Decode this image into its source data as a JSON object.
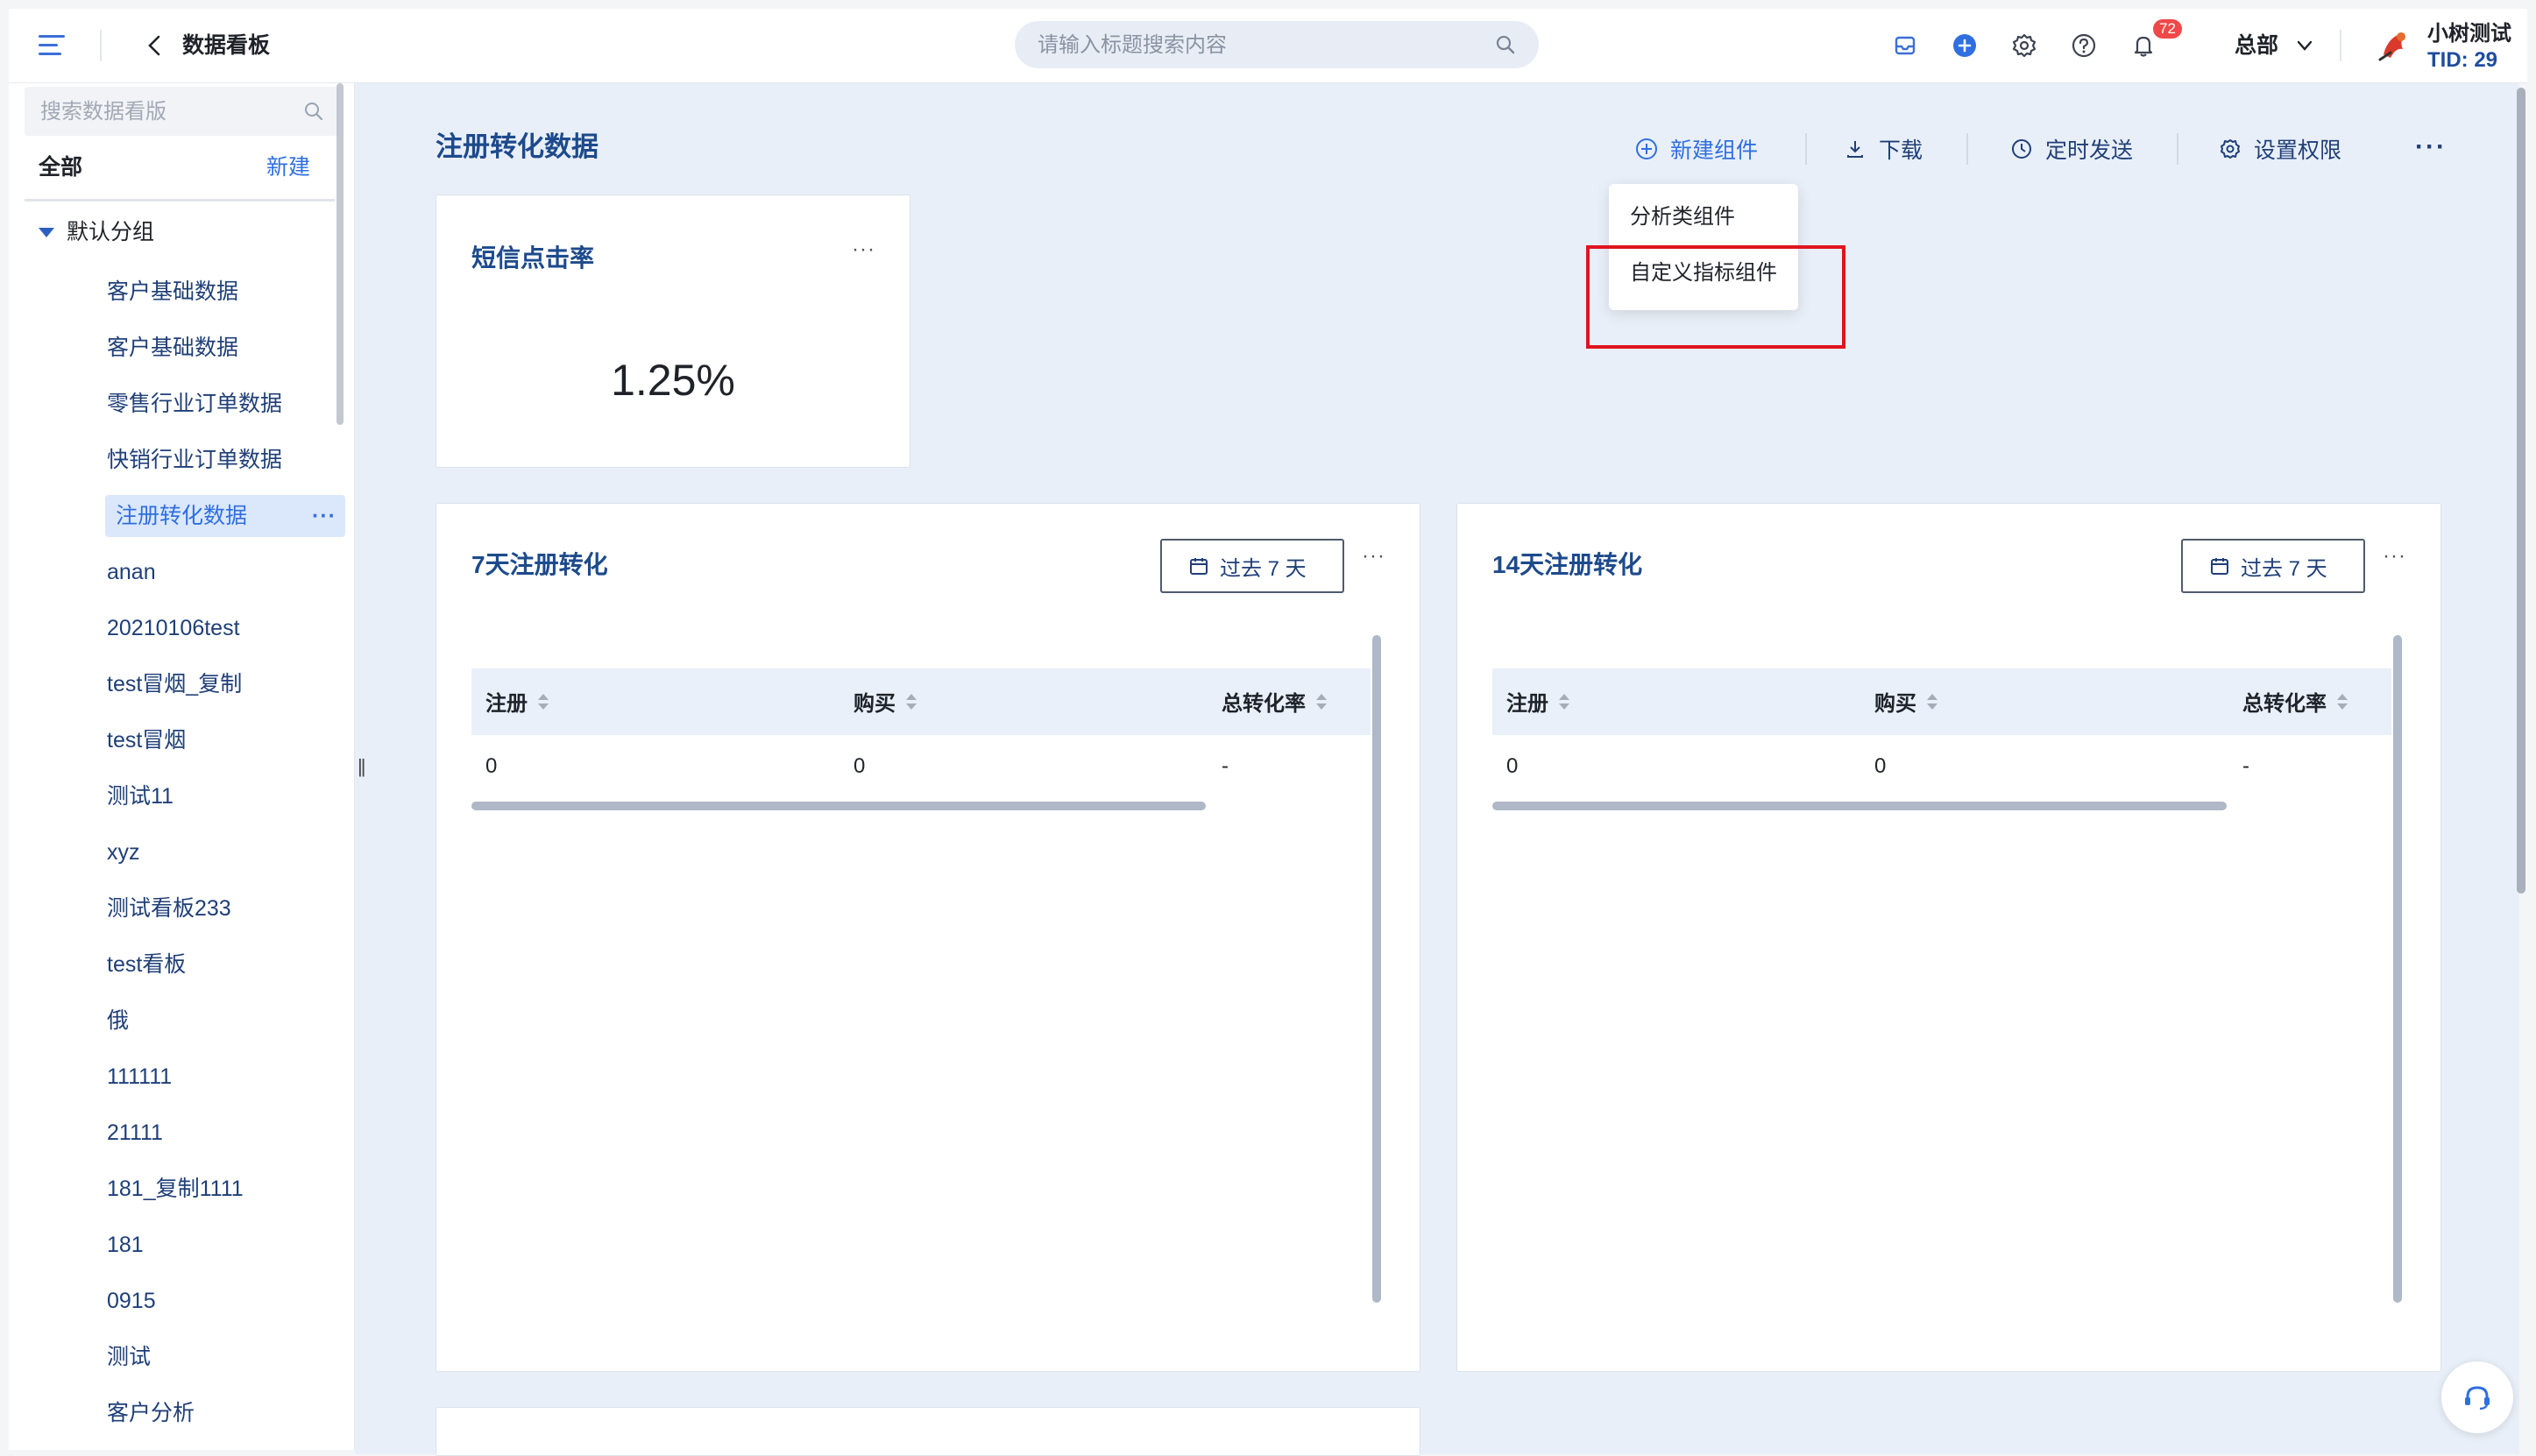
{
  "header": {
    "page_name": "数据看板",
    "search_placeholder": "请输入标题搜索内容",
    "notification_count": "72",
    "org_name": "总部",
    "user_name": "小树测试",
    "user_tid": "TID: 29"
  },
  "sidebar": {
    "search_placeholder": "搜索数据看版",
    "all_label": "全部",
    "new_label": "新建",
    "group_label": "默认分组",
    "items": [
      {
        "label": "客户基础数据"
      },
      {
        "label": "客户基础数据"
      },
      {
        "label": "零售行业订单数据"
      },
      {
        "label": "快销行业订单数据"
      },
      {
        "label": "注册转化数据",
        "active": true
      },
      {
        "label": "anan"
      },
      {
        "label": "20210106test"
      },
      {
        "label": "test冒烟_复制"
      },
      {
        "label": "test冒烟"
      },
      {
        "label": "测试11"
      },
      {
        "label": "xyz"
      },
      {
        "label": "测试看板233"
      },
      {
        "label": "test看板"
      },
      {
        "label": "俄"
      },
      {
        "label": "111111"
      },
      {
        "label": "21111"
      },
      {
        "label": "181_复制1111"
      },
      {
        "label": "181"
      },
      {
        "label": "0915"
      },
      {
        "label": "测试"
      },
      {
        "label": "客户分析"
      }
    ],
    "active_more": "···"
  },
  "dashboard": {
    "title": "注册转化数据",
    "toolbar": {
      "new_component": "新建组件",
      "download": "下载",
      "schedule_send": "定时发送",
      "permissions": "设置权限",
      "more": "···"
    },
    "dropdown": {
      "analysis_component": "分析类组件",
      "custom_metric_component": "自定义指标组件"
    },
    "cards": {
      "sms": {
        "title": "短信点击率",
        "value": "1.25%",
        "menu": "···"
      },
      "week": {
        "title": "7天注册转化",
        "range": "过去 7 天",
        "menu": "···",
        "columns": [
          "注册",
          "购买",
          "总转化率"
        ],
        "row": [
          "0",
          "0",
          "-"
        ]
      },
      "twoweek": {
        "title": "14天注册转化",
        "range": "过去 7 天",
        "menu": "···",
        "columns": [
          "注册",
          "购买",
          "总转化率"
        ],
        "row": [
          "0",
          "0",
          "-"
        ]
      }
    }
  },
  "colors": {
    "accent": "#2f6fe0",
    "title_blue": "#1d4a8c",
    "highlight_red": "#e0141e",
    "badge_red": "#f04848"
  }
}
